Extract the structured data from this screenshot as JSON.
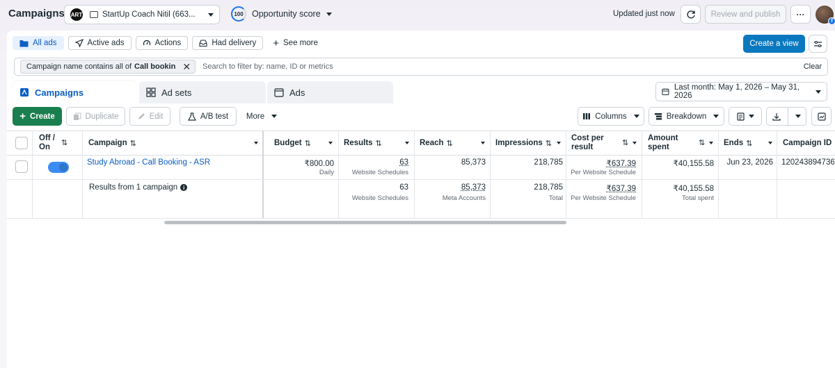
{
  "header": {
    "title": "Campaigns",
    "account_logo": "ART",
    "account_name": "StartUp Coach Nitil (663...",
    "opportunity_value": "100",
    "opportunity_label": "Opportunity score",
    "updated": "Updated just now",
    "review_publish": "Review and publish",
    "more_label": "···"
  },
  "filter_tabs": [
    {
      "label": "All ads",
      "icon": "folder-icon"
    },
    {
      "label": "Active ads",
      "icon": "send-icon"
    },
    {
      "label": "Actions",
      "icon": "gauge-icon"
    },
    {
      "label": "Had delivery",
      "icon": "inbox-icon"
    }
  ],
  "see_more": "See more",
  "create_view": "Create a view",
  "search": {
    "chip_prefix": "Campaign name contains all of",
    "chip_value": "Call bookin",
    "placeholder": "Search to filter by: name, ID or metrics",
    "clear": "Clear"
  },
  "level_tabs": {
    "campaigns": "Campaigns",
    "adsets": "Ad sets",
    "ads": "Ads"
  },
  "date_range": "Last month: May 1, 2026 – May 31, 2026",
  "toolbar": {
    "create": "Create",
    "duplicate": "Duplicate",
    "edit": "Edit",
    "ab_test": "A/B test",
    "more": "More",
    "columns": "Columns",
    "breakdown": "Breakdown"
  },
  "columns": {
    "off_on": "Off / On",
    "campaign": "Campaign",
    "budget": "Budget",
    "results": "Results",
    "reach": "Reach",
    "impressions": "Impressions",
    "cost_per_result": "Cost per result",
    "amount_spent": "Amount spent",
    "ends": "Ends",
    "campaign_id": "Campaign ID"
  },
  "row": {
    "name": "Study Abroad - Call Booking - ASR",
    "budget": "₹800.00",
    "budget_sub": "Daily",
    "results": "63",
    "results_sub": "Website Schedules",
    "reach": "85,373",
    "impressions": "218,785",
    "cost": "₹637.39",
    "cost_sub": "Per Website Schedule",
    "spent": "₹40,155.58",
    "ends": "Jun 23, 2026",
    "id": "120243894736"
  },
  "summary": {
    "label": "Results from 1 campaign",
    "results": "63",
    "results_sub": "Website Schedules",
    "reach": "85,373",
    "reach_sub": "Meta Accounts",
    "impressions": "218,785",
    "impressions_sub": "Total",
    "cost": "₹637.39",
    "cost_sub": "Per Website Schedule",
    "spent": "₹40,155.58",
    "spent_sub": "Total spent"
  },
  "colors": {
    "primary_blue": "#0a78be",
    "create_green": "#1a7f4e",
    "link": "#0a5dc2"
  }
}
